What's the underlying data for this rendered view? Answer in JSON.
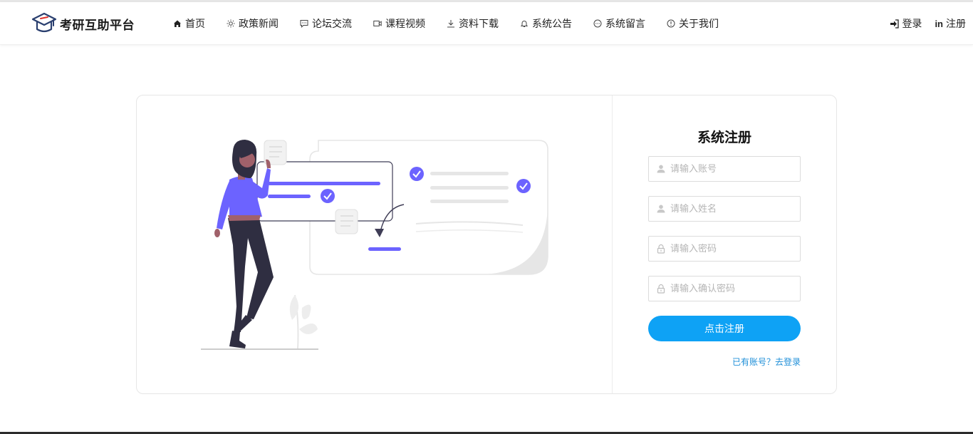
{
  "brand": {
    "name": "考研互助平台",
    "accent": "#0ea2f5",
    "primary_illustration": "#6c63ff"
  },
  "nav": [
    {
      "label": "首页",
      "icon": "home-icon"
    },
    {
      "label": "政策新闻",
      "icon": "sun-icon"
    },
    {
      "label": "论坛交流",
      "icon": "chat-bubble-icon"
    },
    {
      "label": "课程视频",
      "icon": "video-icon"
    },
    {
      "label": "资料下载",
      "icon": "download-icon"
    },
    {
      "label": "系统公告",
      "icon": "bell-icon"
    },
    {
      "label": "系统留言",
      "icon": "message-icon"
    },
    {
      "label": "关于我们",
      "icon": "info-icon"
    }
  ],
  "auth": {
    "login": "登录",
    "register": "注册"
  },
  "form": {
    "title": "系统注册",
    "account_placeholder": "请输入账号",
    "name_placeholder": "请输入姓名",
    "password_placeholder": "请输入密码",
    "confirm_placeholder": "请输入确认密码",
    "submit": "点击注册",
    "login_link": "已有账号？去登录"
  }
}
